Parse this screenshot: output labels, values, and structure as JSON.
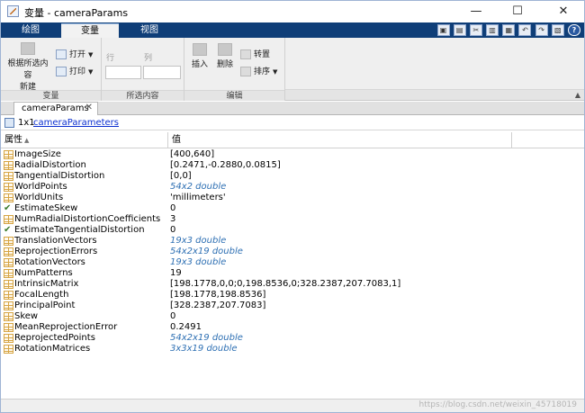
{
  "window": {
    "title": "变量 - cameraParams",
    "minimize": "—",
    "maximize": "☐",
    "close": "✕"
  },
  "ribbon_tabs": [
    "绘图",
    "变量",
    "视图"
  ],
  "quick_access": [
    "▣",
    "▤",
    "✂",
    "▥",
    "▦",
    "↶",
    "↷",
    "▧",
    "?"
  ],
  "ribbon": {
    "variable_group": {
      "new_from_selection": "根据所选内容\n新建",
      "open": "打开",
      "print": "打印",
      "label": "变量"
    },
    "selection_group": {
      "row_label": "行",
      "col_label": "列",
      "row_value": "",
      "col_value": "",
      "label": "所选内容"
    },
    "edit_group": {
      "insert": "插入",
      "delete": "删除",
      "transpose": "转置",
      "sort": "排序",
      "label": "编辑"
    },
    "collapse": "▲"
  },
  "doc_tab": {
    "label": "cameraParams",
    "close": "✕"
  },
  "infobar": {
    "size": "1x1",
    "class_link": "cameraParameters"
  },
  "table": {
    "header_property": "属性",
    "header_value": "值",
    "sort_indicator": "▲",
    "rows": [
      {
        "name": "ImageSize",
        "value": "[400,640]",
        "dim": false,
        "check": false
      },
      {
        "name": "RadialDistortion",
        "value": "[0.2471,-0.2880,0.0815]",
        "dim": false,
        "check": false
      },
      {
        "name": "TangentialDistortion",
        "value": "[0,0]",
        "dim": false,
        "check": false
      },
      {
        "name": "WorldPoints",
        "value": "54x2 double",
        "dim": true,
        "check": false
      },
      {
        "name": "WorldUnits",
        "value": "'millimeters'",
        "dim": false,
        "check": false
      },
      {
        "name": "EstimateSkew",
        "value": "0",
        "dim": false,
        "check": true
      },
      {
        "name": "NumRadialDistortionCoefficients",
        "value": "3",
        "dim": false,
        "check": false
      },
      {
        "name": "EstimateTangentialDistortion",
        "value": "0",
        "dim": false,
        "check": true
      },
      {
        "name": "TranslationVectors",
        "value": "19x3 double",
        "dim": true,
        "check": false
      },
      {
        "name": "ReprojectionErrors",
        "value": "54x2x19 double",
        "dim": true,
        "check": false
      },
      {
        "name": "RotationVectors",
        "value": "19x3 double",
        "dim": true,
        "check": false
      },
      {
        "name": "NumPatterns",
        "value": "19",
        "dim": false,
        "check": false
      },
      {
        "name": "IntrinsicMatrix",
        "value": "[198.1778,0,0;0,198.8536,0;328.2387,207.7083,1]",
        "dim": false,
        "check": false
      },
      {
        "name": "FocalLength",
        "value": "[198.1778,198.8536]",
        "dim": false,
        "check": false
      },
      {
        "name": "PrincipalPoint",
        "value": "[328.2387,207.7083]",
        "dim": false,
        "check": false
      },
      {
        "name": "Skew",
        "value": "0",
        "dim": false,
        "check": false
      },
      {
        "name": "MeanReprojectionError",
        "value": "0.2491",
        "dim": false,
        "check": false
      },
      {
        "name": "ReprojectedPoints",
        "value": "54x2x19 double",
        "dim": true,
        "check": false
      },
      {
        "name": "RotationMatrices",
        "value": "3x3x19 double",
        "dim": true,
        "check": false
      }
    ]
  },
  "statusbar": {
    "watermark": "https://blog.csdn.net/weixin_45718019"
  }
}
